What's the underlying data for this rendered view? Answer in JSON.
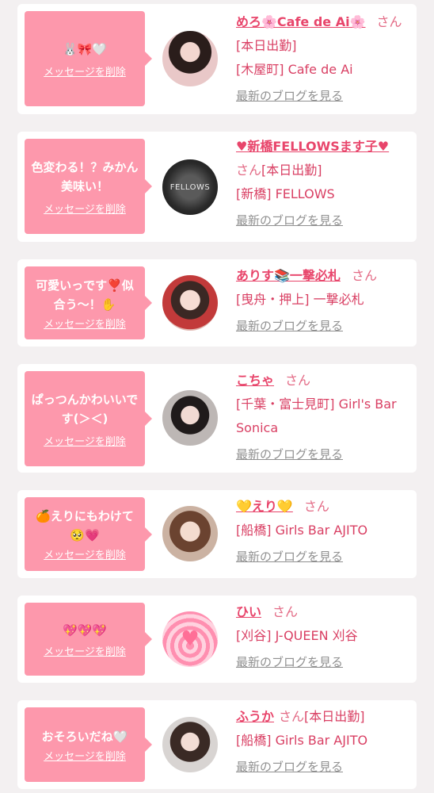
{
  "common": {
    "delete_label": "メッセージを削除",
    "blog_label": "最新のブログを見る"
  },
  "colors": {
    "bubble": "#fd98ac",
    "name": "#e8456b",
    "text": "#d93f63",
    "link_gray": "#909090"
  },
  "entries": [
    {
      "message": "🐰🎀🤍",
      "name": "めろ🌸Cafe de Ai🌸",
      "suffix": "さん",
      "lines": [
        "[本日出勤]",
        "[木屋町] Cafe de Ai"
      ]
    },
    {
      "message": "色変わる！？みかん美味い！",
      "name": "♥新橋FELLOWSます子♥",
      "suffix": "さん",
      "lines": [
        "[本日出勤]",
        "[新橋] FELLOWS"
      ],
      "avatar_text": "FELLOWS"
    },
    {
      "message": "可愛いっです❣️似合う〜！✋",
      "name": "ありす📚一撃必札",
      "suffix": "さん",
      "lines": [
        "[曳舟・押上] 一撃必札"
      ]
    },
    {
      "message": "ぱっつんかわいいです(＞＜)",
      "name": "こちゃ",
      "suffix": "さん",
      "lines": [
        "[千葉・富士見町] Girl's Bar",
        "Sonica"
      ]
    },
    {
      "message": "🍊えりにもわけて🥺💗",
      "name": "💛えり💛",
      "suffix": "さん",
      "lines": [
        "[船橋] Girls Bar AJITO"
      ]
    },
    {
      "message": "💖💖💖",
      "name": "ひい",
      "suffix": "さん",
      "lines": [
        "[刈谷] J-QUEEN 刈谷"
      ]
    },
    {
      "message": "おそろいだね🤍",
      "name": "ふうか",
      "suffix": "さん",
      "lines": [
        "[本日出勤]",
        "[船橋] Girls Bar AJITO"
      ]
    }
  ]
}
